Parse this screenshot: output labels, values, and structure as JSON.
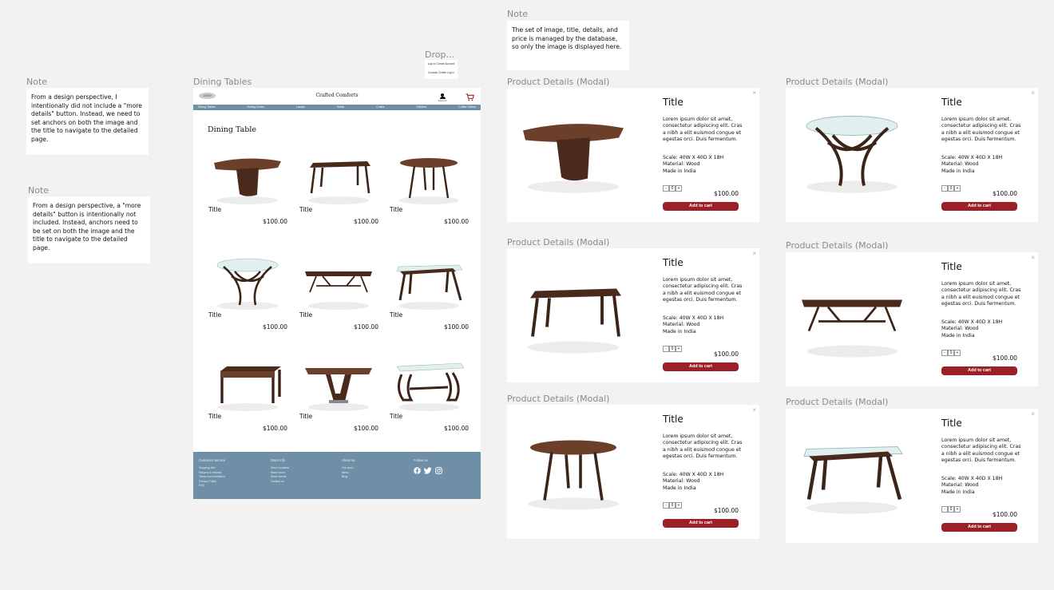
{
  "notes": [
    {
      "label": "Note",
      "text": "From a design perspective, I  intentionally did not include a \"more details\" button. Instead, we need to set anchors on both the image and the title to navigate to the detailed page."
    },
    {
      "label": "Note",
      "text": "From a design perspective,  a \"more details\" button is intentionally not included. Instead, anchors need to be set on both the image and the title to navigate to the detailed page."
    },
    {
      "label": "Note",
      "text": "The set of image, title, details, and price is managed by the database, so only the image is displayed here."
    }
  ],
  "dining_frame_label": "Dining Tables",
  "dropdown": {
    "label": "Drop...",
    "items": [
      "Log In/ Create Account",
      "Contact/ Create Log In"
    ]
  },
  "header": {
    "logo": "LOGO",
    "brand": "Crafted Comforts",
    "account_label": "Account"
  },
  "nav": [
    "Dining Tables",
    "Dining Chairs",
    "Lamps",
    "Sofas",
    "Chairs",
    "Shelves",
    "Coffee Tables"
  ],
  "page_title": "Dining Table",
  "products": [
    {
      "title": "Title",
      "price": "$100.00",
      "image": "pedestal-table"
    },
    {
      "title": "Title",
      "price": "$100.00",
      "image": "rect-table"
    },
    {
      "title": "Title",
      "price": "$100.00",
      "image": "round-table"
    },
    {
      "title": "Title",
      "price": "$100.00",
      "image": "glass-round-table"
    },
    {
      "title": "Title",
      "price": "$100.00",
      "image": "long-table"
    },
    {
      "title": "Title",
      "price": "$100.00",
      "image": "glass-angled-table"
    },
    {
      "title": "Title",
      "price": "$100.00",
      "image": "block-table"
    },
    {
      "title": "Title",
      "price": "$100.00",
      "image": "v-base-table"
    },
    {
      "title": "Title",
      "price": "$100.00",
      "image": "curved-glass-table"
    }
  ],
  "footer": {
    "columns": [
      {
        "heading": "Customer Service",
        "items": [
          "Shipping Info",
          "Returns & refunds",
          "Terms and conditions",
          "Privacy Policy",
          "FAQ"
        ]
      },
      {
        "heading": "Store Info",
        "items": [
          "Store locations",
          "Store hours",
          "Store events",
          "Contact us"
        ]
      },
      {
        "heading": "About us",
        "items": [
          "Our story",
          "News",
          "Blog"
        ]
      },
      {
        "heading": "Follow us",
        "items": []
      }
    ]
  },
  "modal_label": "Product Details (Modal)",
  "modals": [
    {
      "title": "Title",
      "desc": "Lorem ipsum dolor sit amet, consectetur adipiscing elit. Cras a nibh a elit euismod congue et egestas orci. Duis fermentum.",
      "scale": "Scale: 40W X 40D X 18H",
      "material": "Material: Wood",
      "origin": "Made in India",
      "qty": "0",
      "price": "$100.00",
      "button": "Add to cart",
      "close": "×",
      "image": "pedestal-table"
    },
    {
      "title": "Title",
      "desc": "Lorem ipsum dolor sit amet, consectetur adipiscing elit. Cras a nibh a elit euismod congue et egestas orci. Duis fermentum.",
      "scale": "Scale: 40W X 40D X 18H",
      "material": "Material: Wood",
      "origin": "Made in India",
      "qty": "0",
      "price": "$100.00",
      "button": "Add to cart",
      "close": "×",
      "image": "rect-table"
    },
    {
      "title": "Title",
      "desc": "Lorem ipsum dolor sit amet, consectetur adipiscing elit. Cras a nibh a elit euismod congue et egestas orci. Duis fermentum.",
      "scale": "Scale: 40W X 40D X 18H",
      "material": "Material: Wood",
      "origin": "Made in India",
      "qty": "0",
      "price": "$100.00",
      "button": "Add to cart",
      "close": "×",
      "image": "round-table"
    },
    {
      "title": "Title",
      "desc": "Lorem ipsum dolor sit amet, consectetur adipiscing elit. Cras a nibh a elit euismod congue et egestas orci. Duis fermentum.",
      "scale": "Scale: 40W X 40D X 18H",
      "material": "Material: Wood",
      "origin": "Made in India",
      "qty": "0",
      "price": "$100.00",
      "button": "Add to cart",
      "close": "×",
      "image": "glass-round-table"
    },
    {
      "title": "Title",
      "desc": "Lorem ipsum dolor sit amet, consectetur adipiscing elit. Cras a nibh a elit euismod congue et egestas orci. Duis fermentum.",
      "scale": "Scale: 40W X 40D X 18H",
      "material": "Material: Wood",
      "origin": "Made in India",
      "qty": "0",
      "price": "$100.00",
      "button": "Add to cart",
      "close": "×",
      "image": "long-table"
    },
    {
      "title": "Title",
      "desc": "Lorem ipsum dolor sit amet, consectetur adipiscing elit. Cras a nibh a elit euismod congue et egestas orci. Duis fermentum.",
      "scale": "Scale: 40W X 40D X 18H",
      "material": "Material: Wood",
      "origin": "Made in India",
      "qty": "0",
      "price": "$100.00",
      "button": "Add to cart",
      "close": "×",
      "image": "glass-angled-table"
    }
  ],
  "colors": {
    "nav": "#6e8fa6",
    "button": "#9b2027",
    "cart": "#9b2027",
    "wood": "#6b3f2a",
    "background": "#f2f2f2"
  }
}
